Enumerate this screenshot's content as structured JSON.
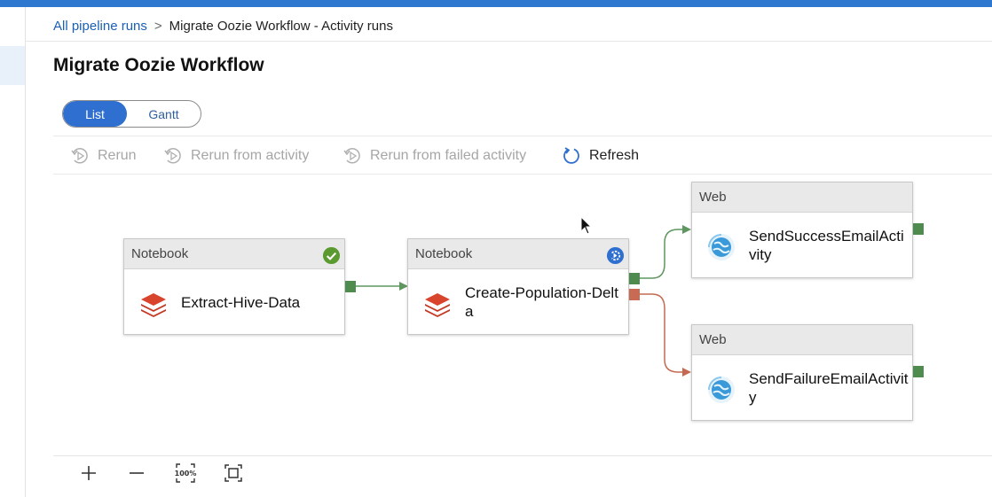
{
  "breadcrumb": {
    "root": "All pipeline runs",
    "separator": ">",
    "current": "Migrate Oozie Workflow - Activity runs"
  },
  "page": {
    "title": "Migrate Oozie Workflow"
  },
  "view_toggle": {
    "list_label": "List",
    "gantt_label": "Gantt",
    "selected": "List"
  },
  "toolbar": {
    "rerun_label": "Rerun",
    "rerun_from_activity_label": "Rerun from activity",
    "rerun_from_failed_label": "Rerun from failed activity",
    "refresh_label": "Refresh"
  },
  "activities": {
    "extract": {
      "type": "Notebook",
      "name": "Extract-Hive-Data",
      "status": "succeeded"
    },
    "create": {
      "type": "Notebook",
      "name": "Create-Population-Delta",
      "status": "in-progress"
    },
    "success_email": {
      "type": "Web",
      "name": "SendSuccessEmailActivity"
    },
    "failure_email": {
      "type": "Web",
      "name": "SendFailureEmailActivity"
    }
  },
  "colors": {
    "accent": "#2f6fcf",
    "success_port": "#4f8a4f",
    "failure_port": "#c96a55",
    "notebook_icon": "#d9442c",
    "web_icon": "#3a9ad9"
  },
  "zoom_controls": {
    "zoom_in_icon": "plus-icon",
    "zoom_out_icon": "minus-icon",
    "reset_zoom_label": "100%",
    "fit_icon": "fit-to-screen-icon"
  }
}
